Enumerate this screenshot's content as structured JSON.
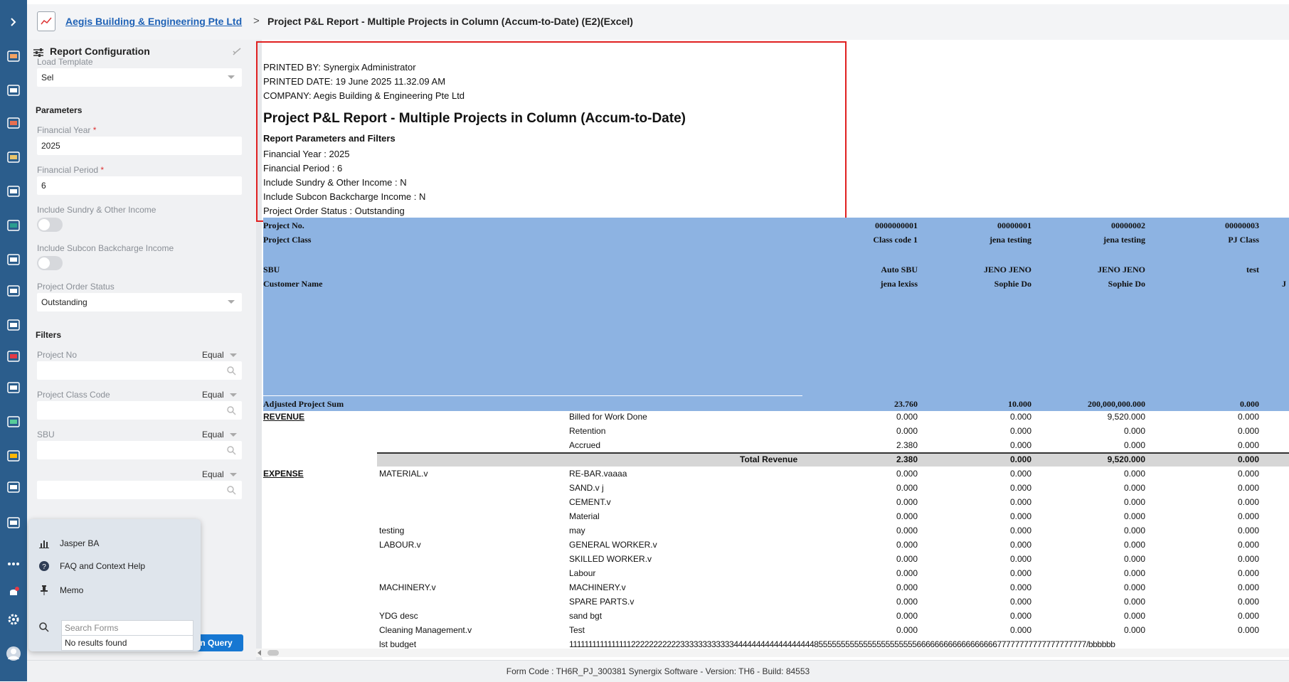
{
  "topbar": {
    "company": "Aegis Building & Engineering Pte Ltd",
    "separator": ">",
    "title": "Project P&L Report - Multiple Projects in Column (Accum-to-Date) (E2)(Excel)"
  },
  "rail_icons": [
    "expand-icon",
    "chart-icon",
    "org-icon",
    "shop-icon",
    "book-icon",
    "doc-icon",
    "cart-icon",
    "report-icon",
    "tools-icon",
    "lab-icon",
    "bars-icon",
    "cloud-icon",
    "download-icon",
    "home-icon",
    "truck-icon",
    "invoice-icon",
    "more-icon",
    "notification-icon",
    "settings-icon",
    "user-avatar-icon"
  ],
  "config": {
    "header": "Report Configuration",
    "load_template_label": "Load Template",
    "load_template_value": "Sel",
    "parameters_title": "Parameters",
    "financial_year_label": "Financial Year",
    "financial_year_value": "2025",
    "financial_period_label": "Financial Period",
    "financial_period_value": "6",
    "required_mark": "*",
    "sundry_label": "Include Sundry & Other Income",
    "subcon_label": "Include Subcon Backcharge Income",
    "order_status_label": "Project Order Status",
    "order_status_value": "Outstanding",
    "filters_title": "Filters",
    "filters": [
      {
        "label": "Project No",
        "op": "Equal"
      },
      {
        "label": "Project Class Code",
        "op": "Equal"
      },
      {
        "label": "SBU",
        "op": "Equal"
      },
      {
        "label": "",
        "op": "Equal"
      }
    ],
    "run_query": "un Query"
  },
  "popup": {
    "items": [
      "Jasper BA",
      "FAQ and Context Help",
      "Memo"
    ],
    "search_placeholder": "Search Forms",
    "no_results": "No results found"
  },
  "report": {
    "printed_by": "PRINTED BY: Synergix Administrator",
    "printed_date": "PRINTED DATE: 19 June 2025 11.32.09 AM",
    "company": "COMPANY: Aegis Building & Engineering Pte Ltd",
    "title": "Project P&L Report - Multiple Projects in Column (Accum-to-Date)",
    "params_title": "Report Parameters and Filters",
    "params": [
      "Financial Year : 2025",
      "Financial Period : 6",
      "Include Sundry & Other Income : N",
      "Include Subcon Backcharge Income : N",
      "Project Order Status : Outstanding"
    ],
    "header_rows": {
      "project_no_label": "Project No.",
      "project_class_label": "Project Class",
      "sbu_label": "SBU",
      "customer_label": "Customer Name",
      "adjusted_label": "Adjusted Project Sum"
    },
    "columns": [
      {
        "project_no": "0000000001",
        "class": "Class code 1",
        "sbu": "Auto SBU",
        "customer": "jena lexiss",
        "adjusted": "23.760"
      },
      {
        "project_no": "00000001",
        "class": "jena testing",
        "sbu": "JENO JENO",
        "customer": "Sophie Do",
        "adjusted": "10.000"
      },
      {
        "project_no": "00000002",
        "class": "jena testing",
        "sbu": "JENO JENO",
        "customer": "Sophie Do",
        "adjusted": "200,000,000.000"
      },
      {
        "project_no": "00000003",
        "class": "PJ Class",
        "sbu": "test",
        "customer": "",
        "adjusted": "0.000"
      }
    ],
    "trailing_char": "J",
    "revenue_label": "REVENUE",
    "expense_label": "EXPENSE",
    "total_revenue_label": "Total Revenue",
    "revenue_rows": [
      {
        "item": "Billed for Work Done",
        "vals": [
          "0.000",
          "0.000",
          "9,520.000",
          "0.000"
        ]
      },
      {
        "item": "Retention",
        "vals": [
          "0.000",
          "0.000",
          "0.000",
          "0.000"
        ]
      },
      {
        "item": "Accrued",
        "vals": [
          "2.380",
          "0.000",
          "0.000",
          "0.000"
        ]
      }
    ],
    "total_revenue_vals": [
      "2.380",
      "0.000",
      "9,520.000",
      "0.000"
    ],
    "expense_rows": [
      {
        "group": "MATERIAL.v",
        "item": "RE-BAR.vaaaa",
        "vals": [
          "0.000",
          "0.000",
          "0.000",
          "0.000"
        ]
      },
      {
        "group": "",
        "item": "SAND.v j",
        "vals": [
          "0.000",
          "0.000",
          "0.000",
          "0.000"
        ]
      },
      {
        "group": "",
        "item": "CEMENT.v",
        "vals": [
          "0.000",
          "0.000",
          "0.000",
          "0.000"
        ]
      },
      {
        "group": "",
        "item": "Material",
        "vals": [
          "0.000",
          "0.000",
          "0.000",
          "0.000"
        ]
      },
      {
        "group": "testing",
        "item": "may",
        "vals": [
          "0.000",
          "0.000",
          "0.000",
          "0.000"
        ]
      },
      {
        "group": "LABOUR.v",
        "item": "GENERAL WORKER.v",
        "vals": [
          "0.000",
          "0.000",
          "0.000",
          "0.000"
        ]
      },
      {
        "group": "",
        "item": "SKILLED WORKER.v",
        "vals": [
          "0.000",
          "0.000",
          "0.000",
          "0.000"
        ]
      },
      {
        "group": "",
        "item": "Labour",
        "vals": [
          "0.000",
          "0.000",
          "0.000",
          "0.000"
        ]
      },
      {
        "group": "MACHINERY.v",
        "item": "MACHINERY.v",
        "vals": [
          "0.000",
          "0.000",
          "0.000",
          "0.000"
        ]
      },
      {
        "group": "",
        "item": "SPARE PARTS.v",
        "vals": [
          "0.000",
          "0.000",
          "0.000",
          "0.000"
        ]
      },
      {
        "group": "YDG desc",
        "item": "sand bgt",
        "vals": [
          "0.000",
          "0.000",
          "0.000",
          "0.000"
        ]
      },
      {
        "group": "Cleaning Management.v",
        "item": "Test",
        "vals": [
          "0.000",
          "0.000",
          "0.000",
          "0.000"
        ]
      }
    ],
    "last_row": {
      "group": "lst budget",
      "overflow_text": "1111111111111111222222222223333333333334444444444444444448555555555555555555555566666666666666666677777777777777777777/bbbbbb"
    }
  },
  "footer": "Form Code : TH6R_PJ_300381    Synergix Software - Version: TH6 - Build: 84553"
}
